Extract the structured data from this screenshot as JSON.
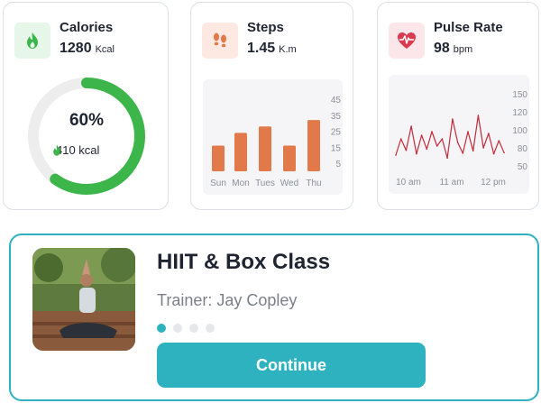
{
  "calories": {
    "title": "Calories",
    "value": "1280",
    "unit": "Kcal",
    "progress_label": "60%",
    "progress": 0.6,
    "burned_label": "410 kcal",
    "icon": "flame-icon",
    "accent_color": "#3cb54a"
  },
  "steps": {
    "title": "Steps",
    "value": "1.45",
    "unit": "K.m",
    "icon": "footprints-icon",
    "bar_color": "#e2794b",
    "chart_data": {
      "type": "bar",
      "categories": [
        "Sun",
        "Mon",
        "Tues",
        "Wed",
        "Thu"
      ],
      "values": [
        16,
        24,
        28,
        16,
        32
      ],
      "ylim": [
        0,
        45
      ],
      "yticks": [
        "45",
        "35",
        "25",
        "15",
        "5"
      ],
      "ytick_values": [
        45,
        35,
        25,
        15,
        5
      ]
    }
  },
  "pulse": {
    "title": "Pulse Rate",
    "value": "98",
    "unit": "bpm",
    "icon": "heart-pulse-icon",
    "line_color": "#c42b3a",
    "chart_data": {
      "type": "line",
      "xticks": [
        "10 am",
        "11 am",
        "12 pm"
      ],
      "yticks": [
        "150",
        "120",
        "100",
        "80",
        "50"
      ],
      "ytick_values": [
        150,
        120,
        100,
        80,
        50
      ],
      "ylim": [
        40,
        160
      ],
      "values": [
        68,
        90,
        76,
        104,
        70,
        94,
        78,
        98,
        82,
        90,
        63,
        112,
        86,
        71,
        98,
        75,
        116,
        80,
        96,
        70,
        88,
        72
      ]
    }
  },
  "class": {
    "title": "HIIT & Box Class",
    "trainer": "Trainer: Jay Copley",
    "button_label": "Continue",
    "pages": 4,
    "active_page": 0,
    "accent_color": "#2fb2bf"
  }
}
